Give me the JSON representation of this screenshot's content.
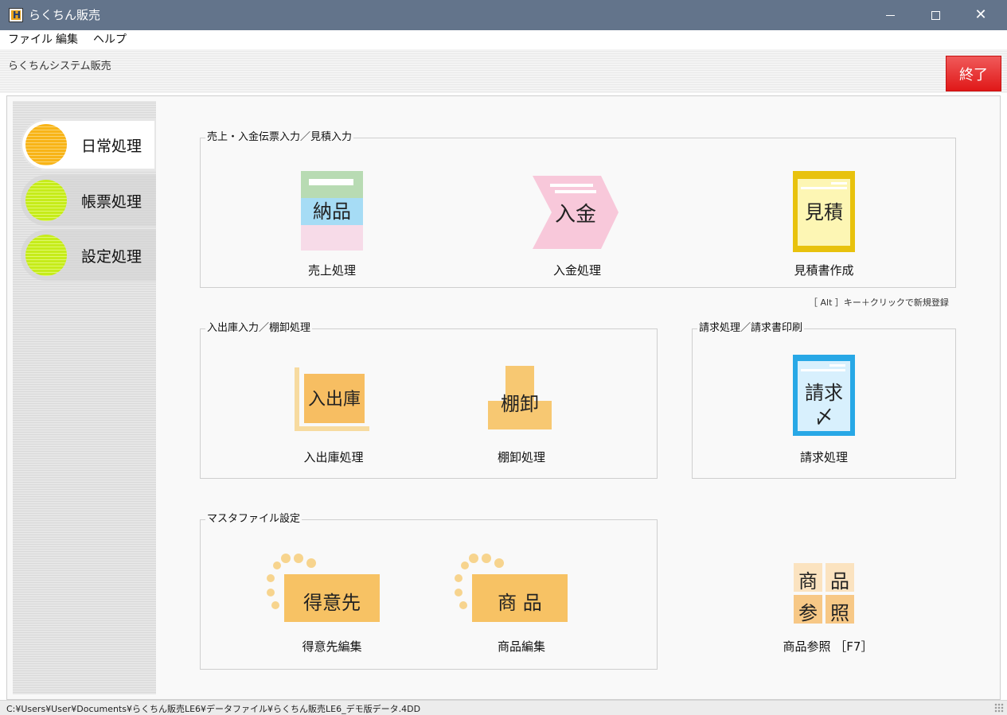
{
  "window": {
    "title": "らくちん販売",
    "icon_letter": "H"
  },
  "menu": {
    "file": "ファイル",
    "edit": "編集",
    "help": "ヘルプ"
  },
  "header": {
    "system_name": "らくちんシステム販売",
    "quit_label": "終了"
  },
  "sidebar": {
    "items": [
      {
        "label": "日常処理",
        "active": true
      },
      {
        "label": "帳票処理",
        "active": false
      },
      {
        "label": "設定処理",
        "active": false
      }
    ]
  },
  "groups": {
    "sales": {
      "title": "売上・入金伝票入力／見積入力",
      "sales_icon": "納品",
      "sales_label": "売上処理",
      "payment_icon": "入金",
      "payment_label": "入金処理",
      "estimate_icon": "見積",
      "estimate_label": "見積書作成"
    },
    "stock": {
      "title": "入出庫入力／棚卸処理",
      "inout_icon": "入出庫",
      "inout_label": "入出庫処理",
      "inventory_icon": "棚卸",
      "inventory_label": "棚卸処理"
    },
    "billing": {
      "title": "請求処理／請求書印刷",
      "billing_icon_1": "請求",
      "billing_icon_2": "〆",
      "billing_label": "請求処理"
    },
    "master": {
      "title": "マスタファイル設定",
      "customer_icon": "得意先",
      "customer_label": "得意先編集",
      "product_icon": "商 品",
      "product_label": "商品編集"
    }
  },
  "product_ref": {
    "icon_1": "商",
    "icon_2": "品",
    "icon_3": "参",
    "icon_4": "照",
    "label": "商品参照 ［F7］"
  },
  "alt_hint": "［ Alt ］キー＋クリックで新規登録",
  "status": {
    "path": "C:¥Users¥User¥Documents¥らくちん販売LE6¥データファイル¥らくちん販売LE6_デモ版データ.4DD"
  }
}
